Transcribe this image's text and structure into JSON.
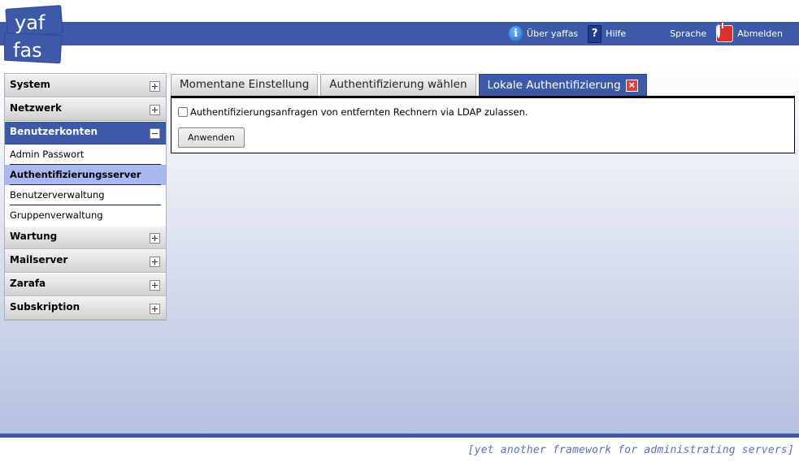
{
  "logo": {
    "line1": "yaf",
    "line2": "fas"
  },
  "topnav": {
    "about": "Über yaffas",
    "help": "Hilfe",
    "language": "Sprache",
    "logout": "Abmelden"
  },
  "sidebar": {
    "sections": [
      {
        "label": "System"
      },
      {
        "label": "Netzwerk"
      },
      {
        "label": "Benutzerkonten"
      },
      {
        "label": "Wartung"
      },
      {
        "label": "Mailserver"
      },
      {
        "label": "Zarafa"
      },
      {
        "label": "Subskription"
      }
    ],
    "sub_items": [
      {
        "label": "Admin Passwort"
      },
      {
        "label": "Authentifizierungsserver"
      },
      {
        "label": "Benutzerverwaltung"
      },
      {
        "label": "Gruppenverwaltung"
      }
    ]
  },
  "tabs": [
    {
      "label": "Momentane Einstellung"
    },
    {
      "label": "Authentifizierung wählen"
    },
    {
      "label": "Lokale Authentifizierung"
    }
  ],
  "form": {
    "checkbox_label": "Authentifizierungsanfragen von entfernten Rechnern via LDAP zulassen.",
    "checkbox_checked": false,
    "apply_button": "Anwenden"
  },
  "footer": {
    "tagline": "[yet another framework for administrating servers]"
  },
  "colors": {
    "brand": "#3c5aa8",
    "selected": "#aab8f2",
    "close": "#e04040"
  }
}
